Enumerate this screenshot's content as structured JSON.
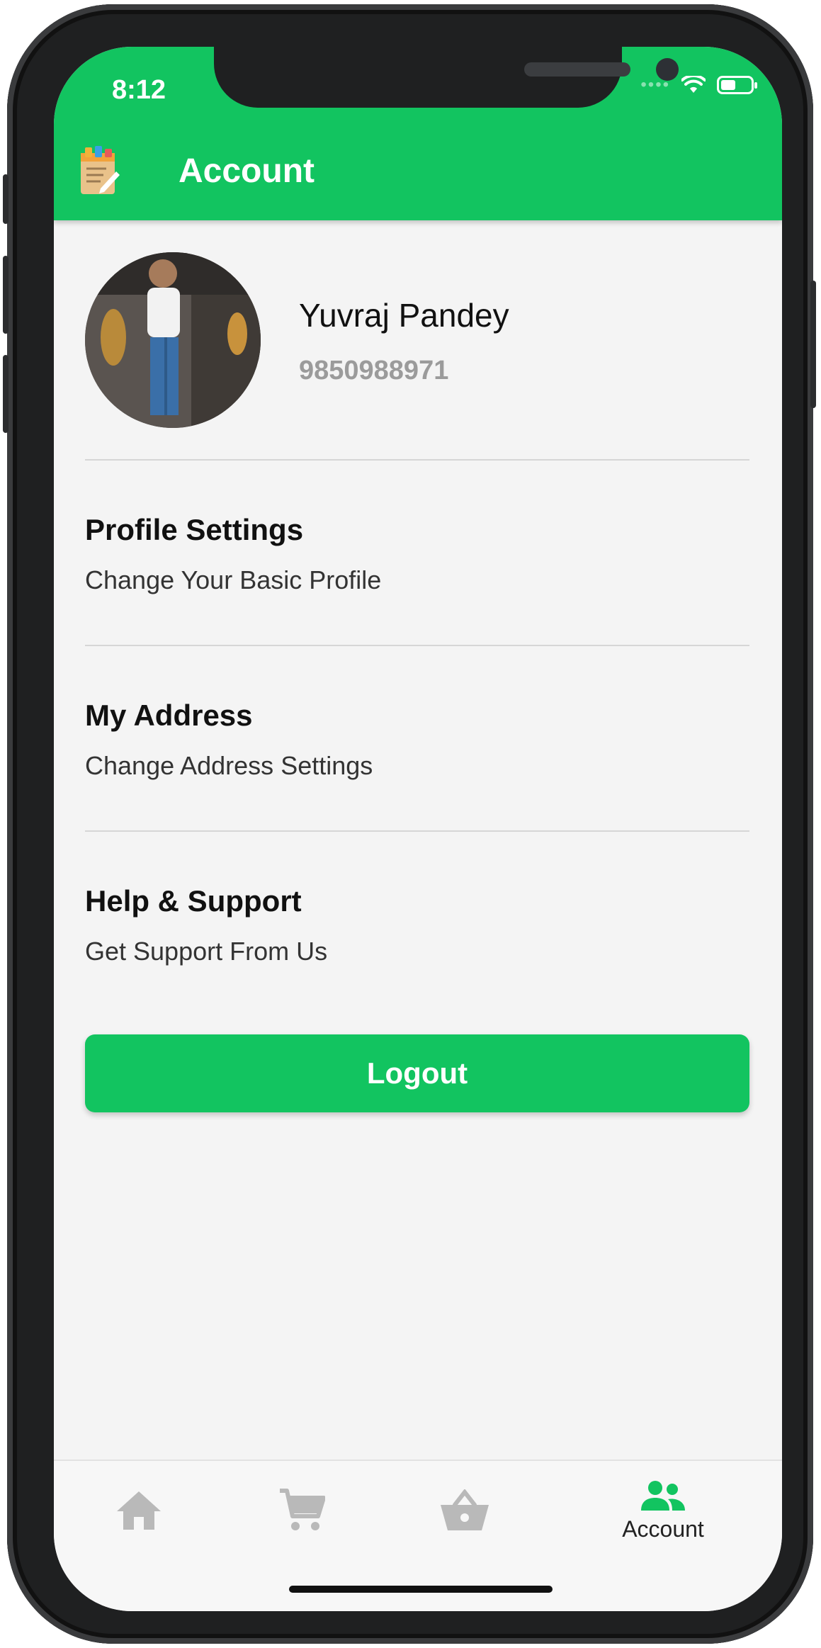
{
  "status_bar": {
    "time": "8:12"
  },
  "app_bar": {
    "title": "Account",
    "logo_icon": "notepad-pencil-icon"
  },
  "profile": {
    "name": "Yuvraj Pandey",
    "phone": "9850988971",
    "avatar": "user-photo"
  },
  "menu": [
    {
      "title": "Profile Settings",
      "subtitle": "Change Your Basic Profile"
    },
    {
      "title": "My Address",
      "subtitle": "Change Address Settings"
    },
    {
      "title": "Help & Support",
      "subtitle": "Get Support From Us"
    }
  ],
  "logout_label": "Logout",
  "bottom_nav": [
    {
      "icon": "home-icon",
      "label": "",
      "active": false
    },
    {
      "icon": "cart-icon",
      "label": "",
      "active": false
    },
    {
      "icon": "basket-icon",
      "label": "",
      "active": false
    },
    {
      "icon": "account-group-icon",
      "label": "Account",
      "active": true
    }
  ],
  "colors": {
    "primary": "#12c460",
    "background": "#f4f4f4",
    "inactive_icon": "#b9b9b9"
  }
}
